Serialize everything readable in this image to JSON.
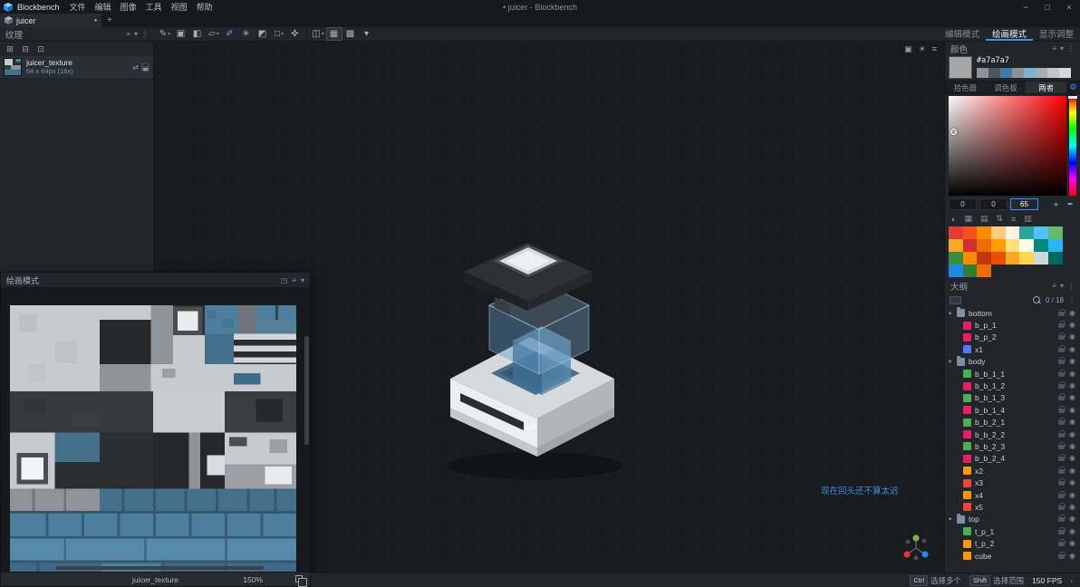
{
  "theme": {
    "accent": "#3e90ff",
    "panel_bg": "#22262c",
    "dark_bg": "#17191d",
    "viewport_bg": "#191b20"
  },
  "icons": {
    "menu": "≡",
    "collapse": "▾",
    "dots": "⋮",
    "expand": "◳",
    "gear": "⚙",
    "eyedropper": "✒",
    "eye": "◉",
    "texture_auto": "⇄"
  },
  "titlebar": {
    "app_name": "Blockbench",
    "menus": [
      "文件",
      "编辑",
      "图像",
      "工具",
      "视图",
      "帮助"
    ],
    "window_title": "• juicer - Blockbench",
    "window_controls": {
      "minimize": "−",
      "maximize": "□",
      "close": "×"
    }
  },
  "tabbar": {
    "tab_label": "juicer",
    "unsaved_dot": "•",
    "new_tab_label": "+"
  },
  "toolbar": {
    "tools": [
      {
        "name": "brush-tool",
        "glyph": "✎",
        "dd": "▾",
        "cls": ""
      },
      {
        "name": "copy-paste-tool",
        "glyph": "▣",
        "dd": "",
        "cls": ""
      },
      {
        "name": "fill-tool",
        "glyph": "◧",
        "dd": "",
        "cls": ""
      },
      {
        "name": "eraser-tool",
        "glyph": "▱",
        "dd": "▾",
        "cls": ""
      },
      {
        "name": "color-picker-tool",
        "glyph": "✐",
        "dd": "",
        "cls": "selected"
      },
      {
        "name": "spray-tool",
        "glyph": "✳",
        "dd": "",
        "cls": ""
      },
      {
        "name": "gradient-tool",
        "glyph": "◩",
        "dd": "",
        "cls": ""
      },
      {
        "name": "shape-tool",
        "glyph": "□",
        "dd": "▾",
        "cls": ""
      },
      {
        "name": "move-tool",
        "glyph": "✜",
        "dd": "",
        "cls": ""
      },
      {
        "name": "toolbar-divider",
        "glyph": "",
        "dd": "",
        "cls": "sep"
      },
      {
        "name": "mirror-paint-toggle",
        "glyph": "◫",
        "dd": "▾",
        "cls": ""
      },
      {
        "name": "pixel-grid-toggle",
        "glyph": "▦",
        "dd": "",
        "cls": "active"
      },
      {
        "name": "painting-grid-toggle",
        "glyph": "▩",
        "dd": "",
        "cls": ""
      },
      {
        "name": "toolbar-more-dropdown",
        "glyph": "▾",
        "dd": "",
        "cls": ""
      }
    ]
  },
  "mode_tabs": {
    "items": [
      {
        "label": "编辑模式",
        "cls": ""
      },
      {
        "label": "绘画模式",
        "cls": "active"
      },
      {
        "label": "显示调整",
        "cls": ""
      }
    ]
  },
  "textures_panel": {
    "title": "纹理",
    "actions": [
      {
        "name": "create-texture-button",
        "glyph": "⊞"
      },
      {
        "name": "import-texture-button",
        "glyph": "⊟"
      },
      {
        "name": "append-texture-button",
        "glyph": "⊡"
      }
    ],
    "texture": {
      "name": "juicer_texture",
      "size": "64 x 64px (16x)"
    }
  },
  "paint_panel": {
    "title": "绘画模式",
    "footer": {
      "texture_name": "juicer_texture",
      "zoom": "150%"
    }
  },
  "viewport": {
    "watermark": "现在回头还不算太迟",
    "corner_icons": [
      {
        "name": "screenshot-icon",
        "glyph": "▣"
      },
      {
        "name": "shading-icon",
        "glyph": "☀"
      },
      {
        "name": "viewport-menu-icon",
        "glyph": "≡"
      }
    ]
  },
  "color_panel": {
    "title": "颜色",
    "hex": "#a7a7a7",
    "history": [
      "#8f9499",
      "#50565e",
      "#3e7ca3",
      "#8d9298",
      "#7fb2d0",
      "#a7adb3",
      "#bfc7ce",
      "#d2d9df"
    ],
    "tabs": [
      {
        "label": "拾色器",
        "cls": ""
      },
      {
        "label": "调色板",
        "cls": ""
      },
      {
        "label": "两者",
        "cls": "active"
      }
    ],
    "hsv": {
      "h": "0",
      "s": "0",
      "v": "65"
    },
    "add_label": "+",
    "picker_icons": [
      {
        "name": "color-wheel-icon",
        "glyph": "◐"
      },
      {
        "name": "swatch-grid-icon",
        "glyph": "▦"
      },
      {
        "name": "palette-rows-icon",
        "glyph": "▤"
      },
      {
        "name": "sort-colors-icon",
        "glyph": "⇅"
      },
      {
        "name": "load-palette-icon",
        "glyph": "≡"
      },
      {
        "name": "palette-menu-icon",
        "glyph": "▥"
      }
    ],
    "palette": [
      "#e53935",
      "#f4511e",
      "#fb8c00",
      "#ffcc80",
      "#fff3e0",
      "#26a69a",
      "#4fc3f7",
      "#66bb6a",
      "#ffa726",
      "#d32f2f",
      "#ef6c00",
      "#ffa000",
      "#ffe082",
      "#fffde7",
      "#00897b",
      "#29b6f6",
      "#388e3c",
      "#fb8c00",
      "#bf360c",
      "#e65100",
      "#f9a825",
      "#ffd54f",
      "#cfd8dc",
      "#00695c",
      "#1e88e5",
      "#2e7d32",
      "#ef6c00"
    ]
  },
  "outline_panel": {
    "title": "大纲",
    "count": "0 / 18",
    "items": [
      {
        "name": "bottom",
        "cls": "folder",
        "chev": "▾",
        "color": ""
      },
      {
        "name": "b_p_1",
        "cls": "child",
        "chev": "",
        "color": "#e91e63"
      },
      {
        "name": "b_p_2",
        "cls": "child",
        "chev": "",
        "color": "#e91e63"
      },
      {
        "name": "x1",
        "cls": "child",
        "chev": "",
        "color": "#5677fc"
      },
      {
        "name": "body",
        "cls": "folder",
        "chev": "▾",
        "color": ""
      },
      {
        "name": "b_b_1_1",
        "cls": "child",
        "chev": "",
        "color": "#4caf50"
      },
      {
        "name": "b_b_1_2",
        "cls": "child",
        "chev": "",
        "color": "#e91e63"
      },
      {
        "name": "b_b_1_3",
        "cls": "child",
        "chev": "",
        "color": "#4caf50"
      },
      {
        "name": "b_b_1_4",
        "cls": "child",
        "chev": "",
        "color": "#e91e63"
      },
      {
        "name": "b_b_2_1",
        "cls": "child",
        "chev": "",
        "color": "#4caf50"
      },
      {
        "name": "b_b_2_2",
        "cls": "child",
        "chev": "",
        "color": "#e91e63"
      },
      {
        "name": "b_b_2_3",
        "cls": "child",
        "chev": "",
        "color": "#4caf50"
      },
      {
        "name": "b_b_2_4",
        "cls": "child",
        "chev": "",
        "color": "#e91e63"
      },
      {
        "name": "x2",
        "cls": "child",
        "chev": "",
        "color": "#ff9800"
      },
      {
        "name": "x3",
        "cls": "child",
        "chev": "",
        "color": "#f44336"
      },
      {
        "name": "x4",
        "cls": "child",
        "chev": "",
        "color": "#ff9800"
      },
      {
        "name": "x5",
        "cls": "child",
        "chev": "",
        "color": "#f44336"
      },
      {
        "name": "top",
        "cls": "folder",
        "chev": "▾",
        "color": ""
      },
      {
        "name": "t_p_1",
        "cls": "child",
        "chev": "",
        "color": "#4caf50"
      },
      {
        "name": "t_p_2",
        "cls": "child",
        "chev": "",
        "color": "#ff9800"
      },
      {
        "name": "cube",
        "cls": "rootcube",
        "chev": "",
        "color": "#ff9800"
      }
    ]
  },
  "statusbar": {
    "hints": [
      {
        "key": "Ctrl",
        "label": "选择多个"
      },
      {
        "key": "Shift",
        "label": "选择范围"
      }
    ],
    "fps": "150 FPS",
    "chevron": "›"
  }
}
